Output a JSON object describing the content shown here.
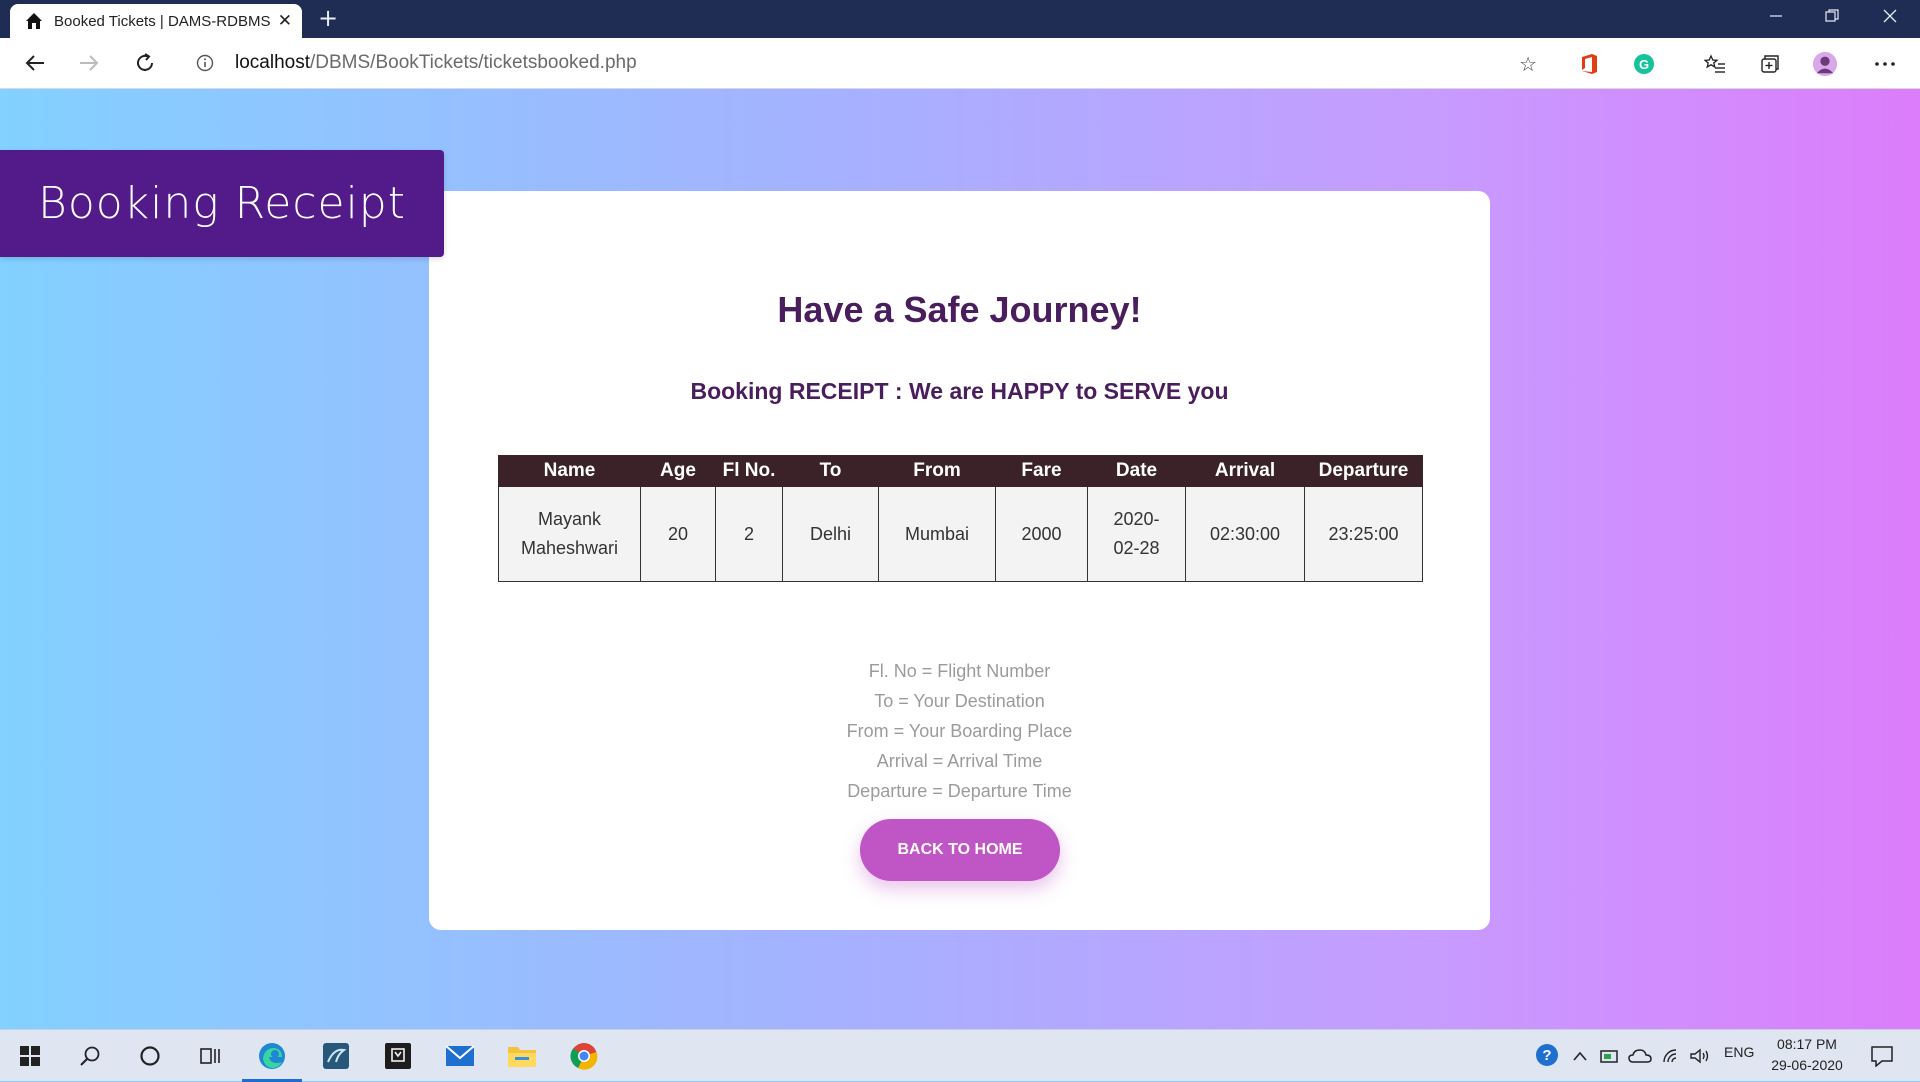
{
  "browser": {
    "tab_title": "Booked Tickets | DAMS-RDBMS",
    "url_host": "localhost",
    "url_path": "/DBMS/BookTickets/ticketsbooked.php"
  },
  "page": {
    "banner": "Booking Receipt",
    "heading": "Have a Safe Journey!",
    "subheading": "Booking RECEIPT : We are HAPPY to SERVE you",
    "table": {
      "headers": [
        "Name",
        "Age",
        "Fl No.",
        "To",
        "From",
        "Fare",
        "Date",
        "Arrival",
        "Departure"
      ],
      "row": {
        "name_first": "Mayank",
        "name_last": "Maheshwari",
        "age": "20",
        "flight_no": "2",
        "to": "Delhi",
        "from": "Mumbai",
        "fare": "2000",
        "date_part1": "2020-",
        "date_part2": "02-28",
        "arrival": "02:30:00",
        "departure": "23:25:00"
      }
    },
    "legend": [
      "Fl. No = Flight Number",
      "To = Your Destination",
      "From = Your Boarding Place",
      "Arrival = Arrival Time",
      "Departure = Departure Time"
    ],
    "back_button": "BACK TO HOME"
  },
  "taskbar": {
    "language": "ENG",
    "time": "08:17 PM",
    "date": "29-06-2020"
  },
  "colors": {
    "banner_bg": "#531a8a",
    "heading": "#4a1d5c",
    "table_header_bg": "#3a2228",
    "button_bg": "#c055c6"
  }
}
